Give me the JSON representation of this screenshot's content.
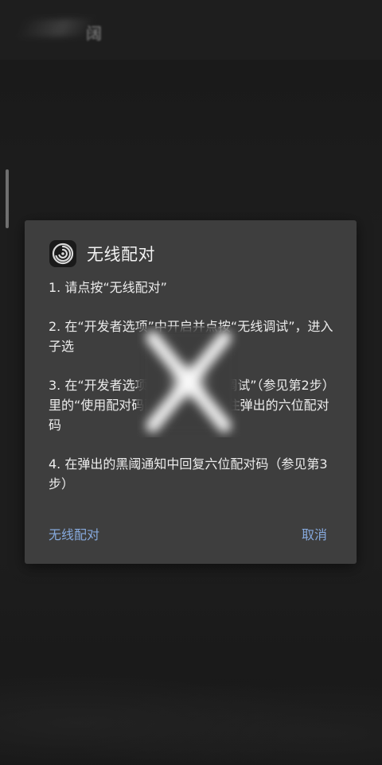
{
  "background": {
    "app_title_fragment": "阔"
  },
  "dialog": {
    "title": "无线配对",
    "icon": "swirl-app-icon",
    "steps": [
      "1. 请点按“无线配对”",
      "2. 在“开发者选项”中开启并点按“无线调试”，进入子选",
      "3. 在“开发者选项”中点按“无线调试”（参见第2步）里的“使用配对码配对设备”，记住弹出的六位配对码",
      "4. 在弹出的黑阈通知中回复六位配对码（参见第3步）"
    ],
    "primary_action": "无线配对",
    "cancel_action": "取消"
  },
  "colors": {
    "dialog_bg": "#3e3e3e",
    "accent": "#86a9dd",
    "text": "#ececec"
  }
}
